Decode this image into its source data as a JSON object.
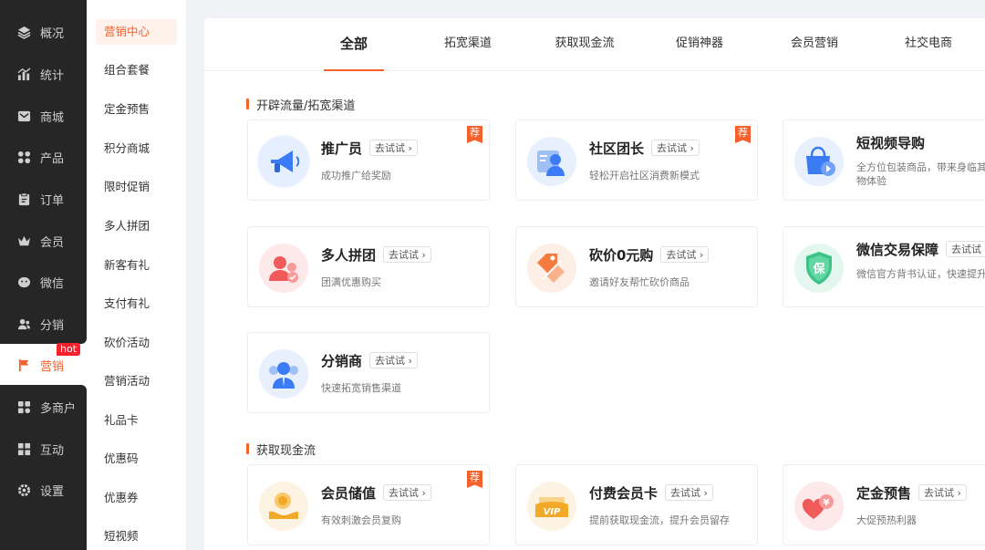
{
  "sidebar": {
    "items": [
      {
        "label": "概况",
        "icon": "layers-icon"
      },
      {
        "label": "统计",
        "icon": "chart-icon"
      },
      {
        "label": "商城",
        "icon": "mail-icon"
      },
      {
        "label": "产品",
        "icon": "grid-icon"
      },
      {
        "label": "订单",
        "icon": "clipboard-icon"
      },
      {
        "label": "会员",
        "icon": "crown-icon"
      },
      {
        "label": "微信",
        "icon": "wechat-icon"
      },
      {
        "label": "分销",
        "icon": "users-icon"
      },
      {
        "label": "营销",
        "icon": "flag-icon"
      },
      {
        "label": "多商户",
        "icon": "store-icon"
      },
      {
        "label": "互动",
        "icon": "apps-icon"
      },
      {
        "label": "设置",
        "icon": "gear-icon"
      }
    ],
    "hot_badge": "hot",
    "active_color": "#f5612d"
  },
  "subnav": {
    "items": [
      "营销中心",
      "组合套餐",
      "定金预售",
      "积分商城",
      "限时促销",
      "多人拼团",
      "新客有礼",
      "支付有礼",
      "砍价活动",
      "营销活动",
      "礼品卡",
      "优惠码",
      "优惠券",
      "短视频"
    ]
  },
  "tabs": [
    "全部",
    "拓宽渠道",
    "获取现金流",
    "促销神器",
    "会员营销",
    "社交电商"
  ],
  "sections": {
    "s1": {
      "title": "开辟流量/拓宽渠道"
    },
    "s2": {
      "title": "获取现金流"
    }
  },
  "try_label": "去试试",
  "rec_label": "荐",
  "cards": {
    "c1": {
      "title": "推广员",
      "desc": "成功推广给奖励"
    },
    "c2": {
      "title": "社区团长",
      "desc": "轻松开启社区消费新模式"
    },
    "c3": {
      "title": "短视频导购",
      "desc": "全方位包装商品，带来身临其境的购物体验"
    },
    "c4": {
      "title": "多人拼团",
      "desc": "团满优惠购买"
    },
    "c5": {
      "title": "砍价0元购",
      "desc": "邀请好友帮忙砍价商品"
    },
    "c6": {
      "title": "微信交易保障",
      "desc": "微信官方背书认证，快速提升信任度"
    },
    "c7": {
      "title": "分销商",
      "desc": "快速拓宽销售渠道"
    },
    "c8": {
      "title": "会员储值",
      "desc": "有效刺激会员复购"
    },
    "c9": {
      "title": "付费会员卡",
      "desc": "提前获取现金流，提升会员留存"
    },
    "c10": {
      "title": "定金预售",
      "desc": "大促预热利器"
    }
  },
  "icon_glyphs": {
    "shield_text": "保",
    "vip_text": "VIP",
    "yen_text": "¥"
  }
}
